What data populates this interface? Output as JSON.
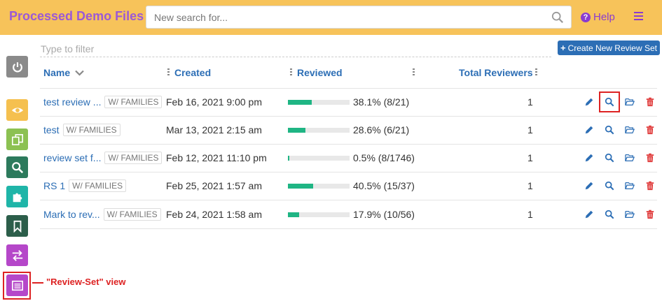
{
  "header": {
    "title": "Processed Demo Files",
    "search_placeholder": "New search for...",
    "help_label": "Help",
    "icons": {
      "search": "search-icon",
      "help": "question-circle-icon",
      "menu": "hamburger-menu-icon"
    }
  },
  "toolbar": {
    "filter_placeholder": "Type to filter",
    "create_label": "Create New Review Set"
  },
  "table": {
    "headers": {
      "name": "Name",
      "created": "Created",
      "reviewed": "Reviewed",
      "total_reviewers": "Total Reviewers"
    },
    "rows": [
      {
        "name": "test review ...",
        "badge": "W/ FAMILIES",
        "created": "Feb 16, 2021 9:00 pm",
        "progress": 0.381,
        "reviewed": "38.1% (8/21)",
        "reviewers": "1"
      },
      {
        "name": "test",
        "badge": "W/ FAMILIES",
        "created": "Mar 13, 2021 2:15 am",
        "progress": 0.286,
        "reviewed": "28.6% (6/21)",
        "reviewers": "1"
      },
      {
        "name": "review set f...",
        "badge": "W/ FAMILIES",
        "created": "Feb 12, 2021 11:10 pm",
        "progress": 0.005,
        "reviewed": "0.5% (8/1746)",
        "reviewers": "1"
      },
      {
        "name": "RS 1",
        "badge": "W/ FAMILIES",
        "created": "Feb 25, 2021 1:57 am",
        "progress": 0.405,
        "reviewed": "40.5% (15/37)",
        "reviewers": "1"
      },
      {
        "name": "Mark to rev...",
        "badge": "W/ FAMILIES",
        "created": "Feb 24, 2021 1:58 am",
        "progress": 0.179,
        "reviewed": "17.9% (10/56)",
        "reviewers": "1"
      }
    ]
  },
  "sidebar": {
    "items": [
      {
        "icon": "power-icon",
        "color": "#8a8a8a"
      },
      {
        "icon": "eye-icon",
        "color": "#f5c04f"
      },
      {
        "icon": "copy-files-icon",
        "color": "#8cc152"
      },
      {
        "icon": "search-icon",
        "color": "#2c7a5c"
      },
      {
        "icon": "puzzle-icon",
        "color": "#1fb5a8"
      },
      {
        "icon": "bookmark-icon",
        "color": "#2c5e4a"
      },
      {
        "icon": "swap-arrows-icon",
        "color": "#b547c9"
      },
      {
        "icon": "review-set-list-icon",
        "color": "#b547c9"
      }
    ]
  },
  "callout": {
    "label": "\"Review-Set\" view"
  },
  "colors": {
    "topbar": "#f7c35a",
    "title": "#9b59d6",
    "link": "#2c6eb5",
    "progress": "#1fb584",
    "delete": "#e03a3a",
    "highlight": "#dd2222"
  }
}
